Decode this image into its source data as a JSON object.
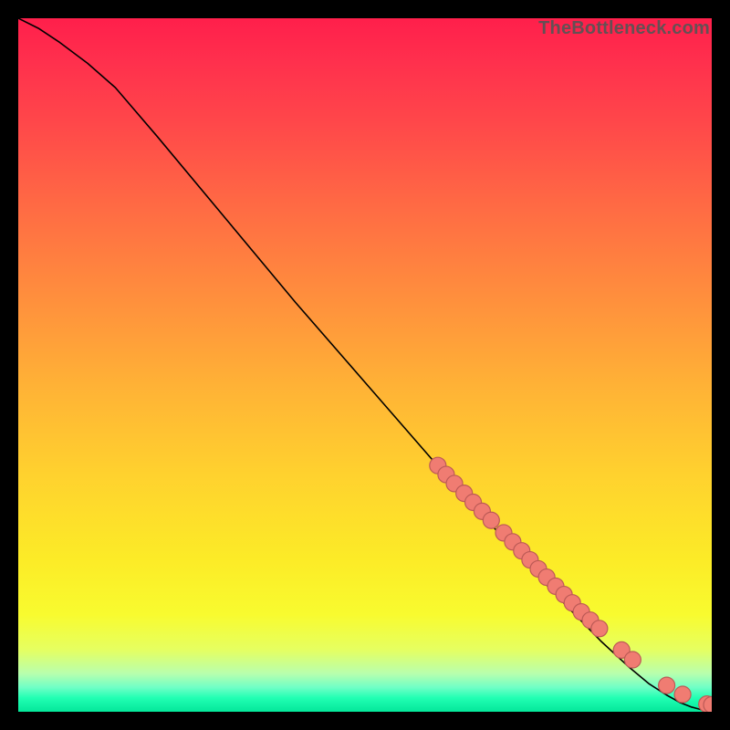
{
  "watermark": "TheBottleneck.com",
  "colors": {
    "point_fill": "#f07c72",
    "point_stroke": "#bc5a56",
    "curve": "#000000"
  },
  "chart_data": {
    "type": "line",
    "title": "",
    "xlabel": "",
    "ylabel": "",
    "xlim": [
      0,
      100
    ],
    "ylim": [
      0,
      100
    ],
    "grid": false,
    "legend": false,
    "series": [
      {
        "name": "curve",
        "x": [
          0,
          3,
          6,
          10,
          14,
          20,
          30,
          40,
          50,
          60,
          65,
          70,
          75,
          80,
          84,
          88,
          91,
          93.5,
          95.5,
          97,
          98.5,
          100
        ],
        "y": [
          100,
          98.5,
          96.5,
          93.5,
          90,
          83,
          71,
          59,
          47.5,
          36,
          30.5,
          25,
          19.5,
          14.3,
          10.2,
          6.5,
          4.0,
          2.4,
          1.3,
          0.7,
          0.3,
          0.15
        ]
      }
    ],
    "points": {
      "name": "highlighted",
      "radius_px": 9,
      "x": [
        60.5,
        61.7,
        62.9,
        64.3,
        65.6,
        66.9,
        68.2,
        70.0,
        71.3,
        72.6,
        73.8,
        75.0,
        76.2,
        77.5,
        78.7,
        79.9,
        81.2,
        82.5,
        83.8,
        87.0,
        88.6,
        93.5,
        95.8,
        99.3,
        100.0
      ],
      "y": [
        35.5,
        34.2,
        32.9,
        31.5,
        30.2,
        28.9,
        27.6,
        25.8,
        24.5,
        23.2,
        21.9,
        20.6,
        19.4,
        18.1,
        16.9,
        15.7,
        14.4,
        13.2,
        12.0,
        8.9,
        7.5,
        3.8,
        2.5,
        1.1,
        1.0
      ]
    }
  }
}
